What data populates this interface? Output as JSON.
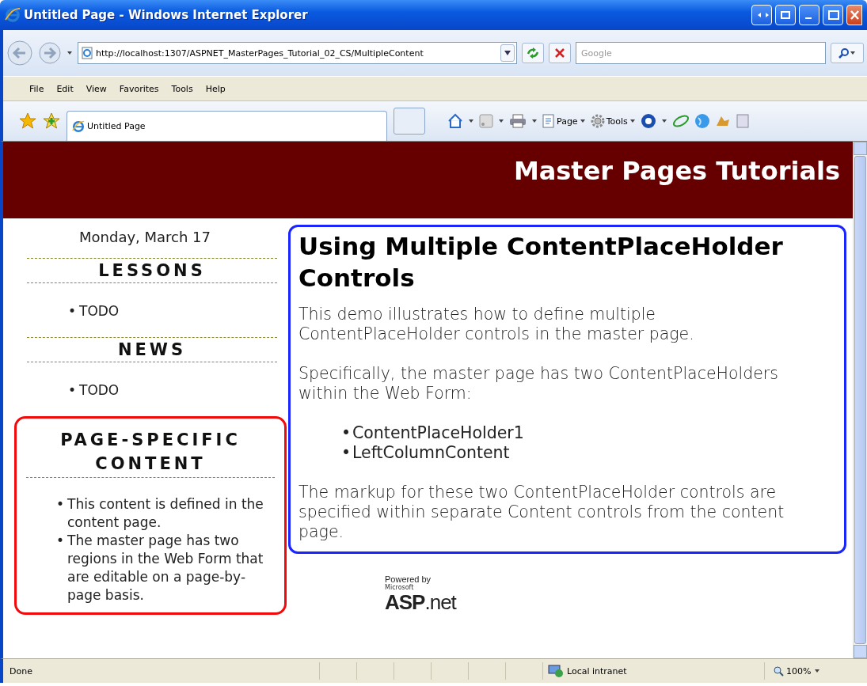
{
  "window": {
    "title": "Untitled Page - Windows Internet Explorer"
  },
  "address_bar": {
    "url": "http://localhost:1307/ASPNET_MasterPages_Tutorial_02_CS/MultipleContent"
  },
  "search": {
    "placeholder": "Google"
  },
  "menu": [
    "File",
    "Edit",
    "View",
    "Favorites",
    "Tools",
    "Help"
  ],
  "tab": {
    "label": "Untitled Page"
  },
  "command_bar": [
    "Page",
    "Tools"
  ],
  "page": {
    "banner": "Master Pages Tutorials",
    "date": "Monday, March 17",
    "left_sections": [
      {
        "heading": "LESSONS",
        "items": [
          {
            "bullet": "•",
            "text": "TODO"
          }
        ]
      },
      {
        "heading": "NEWS",
        "items": [
          {
            "bullet": "•",
            "text": "TODO"
          }
        ]
      }
    ],
    "page_specific": {
      "heading": "PAGE-SPECIFIC CONTENT",
      "items": [
        {
          "bullet": "•",
          "text": "This content is defined in the content page."
        },
        {
          "bullet": "•",
          "text": "The master page has two regions in the Web Form that are editable on a page-by-page basis."
        }
      ]
    },
    "main": {
      "heading": "Using Multiple ContentPlaceHolder Controls",
      "blocks": [
        {
          "kind": "paragraph",
          "lines": [
            "This demo illustrates how to define multiple",
            "ContentPlaceHolder controls in the master page."
          ]
        },
        {
          "kind": "paragraph",
          "lines": [
            "Specifically, the master page has two ContentPlaceHolders",
            "within the Web Form:"
          ]
        },
        {
          "kind": "list",
          "items": [
            {
              "bullet": "•",
              "text": "ContentPlaceHolder1"
            },
            {
              "bullet": "•",
              "text": "LeftColumnContent"
            }
          ]
        },
        {
          "kind": "paragraph",
          "lines": [
            "The markup for these two ContentPlaceHolder controls are",
            "specified within separate Content controls from the content",
            "page."
          ]
        }
      ]
    },
    "footer_logo": {
      "caption": "Powered by",
      "maker": "Microsoft",
      "name": "ASP",
      "suffix": ".net"
    }
  },
  "status_bar": {
    "text": "Done",
    "zone": "Local intranet",
    "zoom": "100%"
  }
}
